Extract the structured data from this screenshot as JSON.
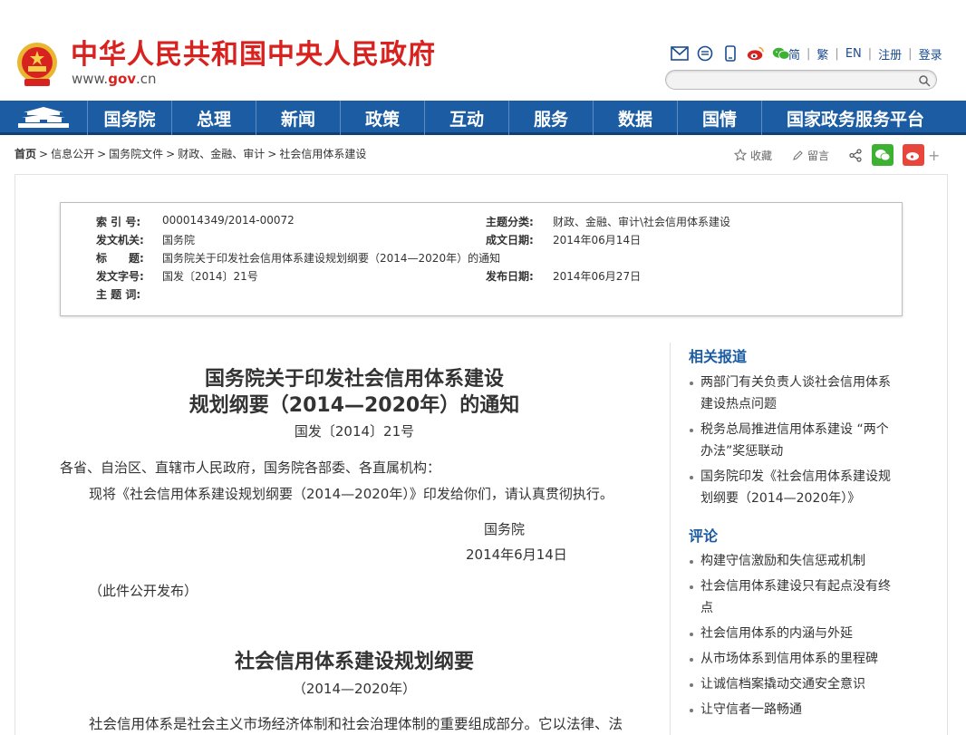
{
  "header": {
    "site_title": "中华人民共和国中央人民政府",
    "url_www": "www.",
    "url_gov": "gov",
    "url_cn": ".cn",
    "social_icons": [
      "mail-icon",
      "message-icon",
      "mobile-icon",
      "weibo-icon",
      "wechat-icon"
    ],
    "top_links": [
      "简",
      "繁",
      "EN",
      "注册",
      "登录"
    ],
    "search_placeholder": ""
  },
  "nav": {
    "items": [
      "国务院",
      "总理",
      "新闻",
      "政策",
      "互动",
      "服务",
      "数据",
      "国情",
      "国家政务服务平台"
    ]
  },
  "breadcrumb": {
    "items": [
      "首页",
      "信息公开",
      "国务院文件",
      "财政、金融、审计",
      "社会信用体系建设"
    ]
  },
  "tools": {
    "collect": "收藏",
    "comment": "留言"
  },
  "meta": {
    "index_label": "索 引 号:",
    "index_value": "000014349/2014-00072",
    "category_label": "主题分类:",
    "category_value": "财政、金融、审计\\社会信用体系建设",
    "issuer_label": "发文机关:",
    "issuer_value": "国务院",
    "created_label": "成文日期:",
    "created_value": "2014年06月14日",
    "title_label": "标　　题:",
    "title_value": "国务院关于印发社会信用体系建设规划纲要（2014—2020年）的通知",
    "docno_label": "发文字号:",
    "docno_value": "国发〔2014〕21号",
    "published_label": "发布日期:",
    "published_value": "2014年06月27日",
    "keywords_label": "主 题 词:",
    "keywords_value": ""
  },
  "article": {
    "title_line1": "国务院关于印发社会信用体系建设",
    "title_line2": "规划纲要（2014—2020年）的通知",
    "doc_number": "国发〔2014〕21号",
    "salutation": "各省、自治区、直辖市人民政府，国务院各部委、各直属机构：",
    "body_line1": "现将《社会信用体系建设规划纲要（2014—2020年）》印发给你们，请认真贯彻执行。",
    "signer": "国务院",
    "date": "2014年6月14日",
    "public_note": "（此件公开发布）",
    "outline_title": "社会信用体系建设规划纲要",
    "outline_years": "（2014—2020年）",
    "outline_body": "社会信用体系是社会主义市场经济体制和社会治理体制的重要组成部分。它以法律、法"
  },
  "sidebar": {
    "related_title": "相关报道",
    "related": [
      [
        "两部门有关负责人谈社会信用体系",
        "建设热点问题"
      ],
      [
        "税务总局推进信用体系建设 “两个",
        "办法”奖惩联动"
      ],
      [
        "国务院印发《社会信用体系建设规",
        "划纲要（2014—2020年）》"
      ]
    ],
    "review_title": "评论",
    "review": [
      [
        "构建守信激励和失信惩戒机制"
      ],
      [
        "社会信用体系建设只有起点没有终",
        "点"
      ],
      [
        "社会信用体系的内涵与外延"
      ],
      [
        "从市场体系到信用体系的里程碑"
      ],
      [
        "让诚信档案撬动交通安全意识"
      ],
      [
        "让守信者一路畅通"
      ]
    ]
  },
  "colors": {
    "brand_red": "#d8221f",
    "nav_blue": "#1b5ca3",
    "link_blue": "#1a4b8f"
  }
}
